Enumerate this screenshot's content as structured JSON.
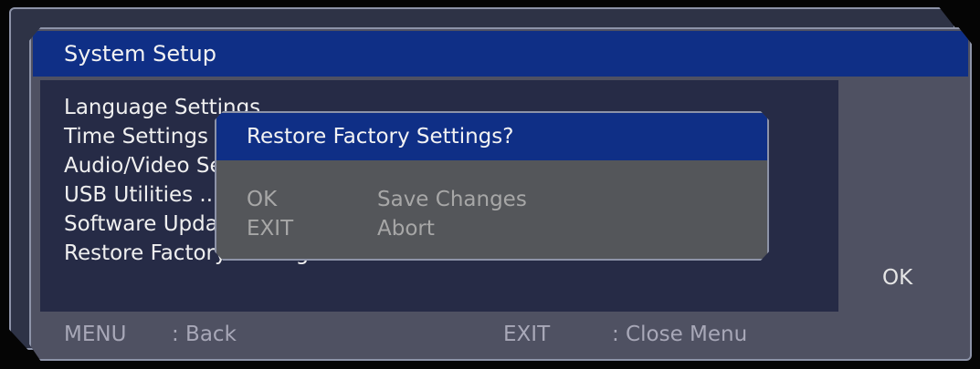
{
  "window": {
    "title": "System Setup"
  },
  "menu": {
    "items": [
      {
        "label": "Language Settings"
      },
      {
        "label": "Time Settings"
      },
      {
        "label": "Audio/Video Settings"
      },
      {
        "label": "USB Utilities ..."
      },
      {
        "label": "Software Update"
      },
      {
        "label": "Restore Factory Settings ..."
      }
    ]
  },
  "side": {
    "ok_label": "OK"
  },
  "footer": {
    "menu_key": "MENU",
    "menu_action": ": Back",
    "exit_key": "EXIT",
    "exit_action": ": Close Menu"
  },
  "dialog": {
    "title": "Restore Factory Settings?",
    "options": [
      {
        "key": "OK",
        "action": "Save Changes"
      },
      {
        "key": "EXIT",
        "action": "Abort"
      }
    ]
  },
  "colors": {
    "title_bar": "#0f2f86",
    "panel": "#4f5162",
    "list_bg": "#262b46",
    "dialog_bg": "#54565a"
  }
}
